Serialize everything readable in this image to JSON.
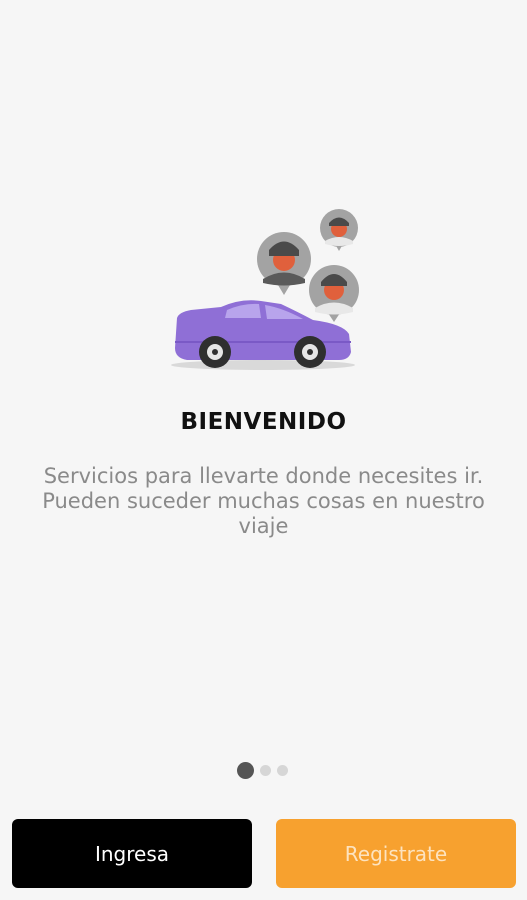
{
  "onboarding": {
    "title": "BIENVENIDO",
    "description": "Servicios para llevarte donde necesites ir. Pueden suceder muchas cosas en nuestro viaje",
    "pages_total": 3,
    "active_page": 1
  },
  "buttons": {
    "login_label": "Ingresa",
    "register_label": "Registrate"
  },
  "colors": {
    "background": "#f6f6f6",
    "car": "#8f6fd6",
    "login_button": "#000000",
    "register_button": "#f7a12f",
    "avatar_bubble": "#a3a3a3",
    "avatar_face": "#e0603c"
  },
  "icons": {
    "illustration": "car-with-passengers-icon"
  }
}
